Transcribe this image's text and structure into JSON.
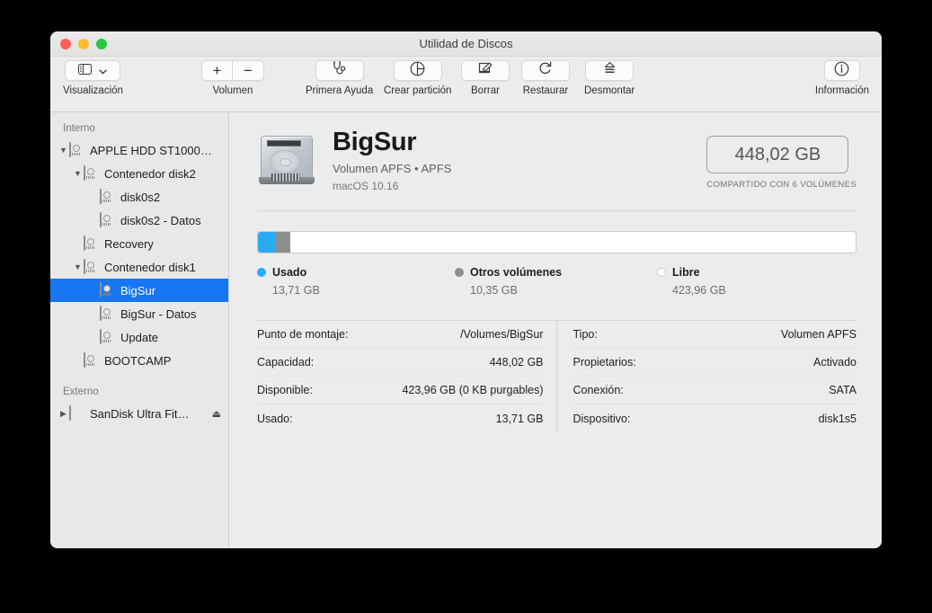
{
  "window": {
    "title": "Utilidad de Discos",
    "traffic": {
      "close": "close-button",
      "minimize": "minimize-button",
      "maximize": "maximize-button"
    }
  },
  "toolbar": {
    "view_label": "Visualización",
    "volume_label": "Volumen",
    "volume_add": "+",
    "volume_remove": "−",
    "items": [
      {
        "label": "Primera Ayuda",
        "icon": "stethoscope-icon"
      },
      {
        "label": "Crear partición",
        "icon": "pie-chart-icon"
      },
      {
        "label": "Borrar",
        "icon": "erase-icon"
      },
      {
        "label": "Restaurar",
        "icon": "restore-icon"
      },
      {
        "label": "Desmontar",
        "icon": "eject-icon"
      }
    ],
    "info_label": "Información"
  },
  "sidebar": {
    "groups": [
      {
        "title": "Interno",
        "items": [
          {
            "label": "APPLE HDD ST1000…",
            "level": 0,
            "twisty": "▼",
            "icon": "hard-drive-icon",
            "selected": false
          },
          {
            "label": "Contenedor disk2",
            "level": 1,
            "twisty": "▼",
            "icon": "hard-drive-icon",
            "selected": false
          },
          {
            "label": "disk0s2",
            "level": 2,
            "twisty": "",
            "icon": "hard-drive-icon",
            "selected": false
          },
          {
            "label": "disk0s2 - Datos",
            "level": 2,
            "twisty": "",
            "icon": "hard-drive-icon",
            "selected": false
          },
          {
            "label": "Recovery",
            "level": 1,
            "twisty": "",
            "icon": "hard-drive-icon",
            "selected": false
          },
          {
            "label": "Contenedor disk1",
            "level": 1,
            "twisty": "▼",
            "icon": "hard-drive-icon",
            "selected": false
          },
          {
            "label": "BigSur",
            "level": 2,
            "twisty": "",
            "icon": "hard-drive-icon",
            "selected": true
          },
          {
            "label": "BigSur - Datos",
            "level": 2,
            "twisty": "",
            "icon": "hard-drive-icon",
            "selected": false
          },
          {
            "label": "Update",
            "level": 2,
            "twisty": "",
            "icon": "hard-drive-icon",
            "selected": false
          },
          {
            "label": "BOOTCAMP",
            "level": 1,
            "twisty": "",
            "icon": "hard-drive-icon",
            "selected": false
          }
        ]
      },
      {
        "title": "Externo",
        "items": [
          {
            "label": "SanDisk Ultra Fit…",
            "level": 0,
            "twisty": "▶",
            "icon": "external-drive-icon",
            "selected": false,
            "eject": "⏏"
          }
        ]
      }
    ]
  },
  "volume": {
    "name": "BigSur",
    "subtitle": "Volumen APFS • APFS",
    "os": "macOS 10.16",
    "capacity_badge": "448,02 GB",
    "capacity_note": "COMPARTIDO CON 6 VOLÚMENES",
    "icon": "hard-drive-large-icon"
  },
  "chart_data": {
    "type": "bar",
    "title": "Uso del volumen BigSur",
    "categories": [
      "Usado",
      "Otros volúmenes",
      "Libre"
    ],
    "values": [
      13.71,
      10.35,
      423.96
    ],
    "unit": "GB",
    "total": 448.02,
    "percents": [
      3.06,
      2.31,
      94.63
    ],
    "colors": [
      "#29abf2",
      "#8e8e8e",
      "#ffffff"
    ],
    "labels": [
      "13,71 GB",
      "10,35 GB",
      "423,96 GB"
    ],
    "legend_position": "below",
    "stacked": true
  },
  "usage": {
    "legend": [
      {
        "name": "Usado",
        "value": "13,71 GB",
        "dot": "used",
        "percent": 3.06
      },
      {
        "name": "Otros volúmenes",
        "value": "10,35 GB",
        "dot": "other",
        "percent": 2.31
      },
      {
        "name": "Libre",
        "value": "423,96 GB",
        "dot": "free",
        "percent": 94.63
      }
    ]
  },
  "details": {
    "left": [
      {
        "label": "Punto de montaje:",
        "value": "/Volumes/BigSur"
      },
      {
        "label": "Capacidad:",
        "value": "448,02 GB"
      },
      {
        "label": "Disponible:",
        "value": "423,96 GB (0 KB purgables)"
      },
      {
        "label": "Usado:",
        "value": "13,71 GB"
      }
    ],
    "right": [
      {
        "label": "Tipo:",
        "value": "Volumen APFS"
      },
      {
        "label": "Propietarios:",
        "value": "Activado"
      },
      {
        "label": "Conexión:",
        "value": "SATA"
      },
      {
        "label": "Dispositivo:",
        "value": "disk1s5"
      }
    ]
  },
  "colors": {
    "accent": "#1876f2",
    "used": "#29abf2",
    "other": "#8e8e8e",
    "free": "#ffffff"
  }
}
